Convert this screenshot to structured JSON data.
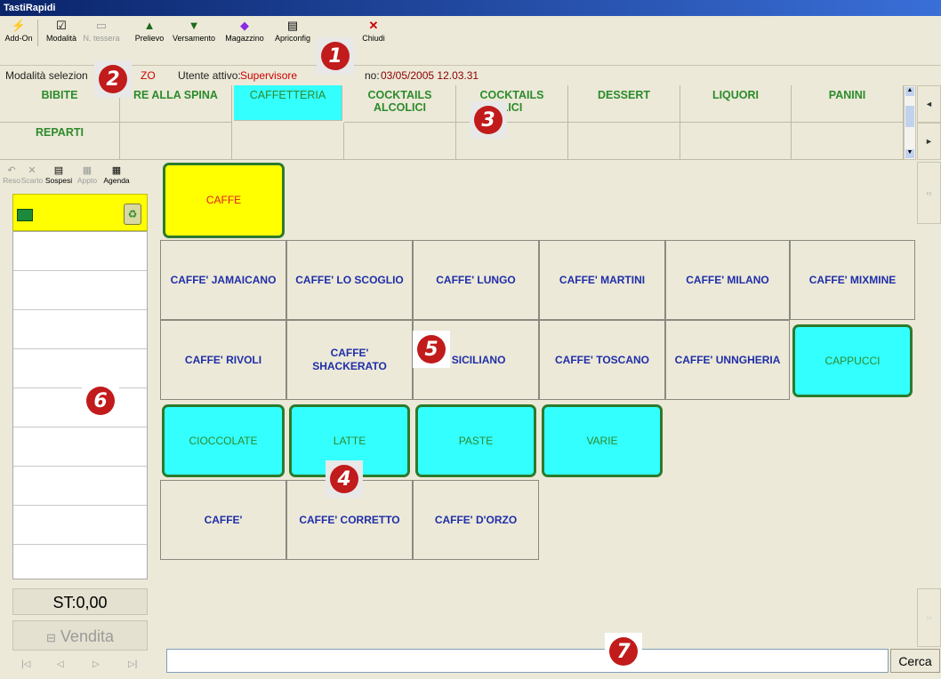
{
  "window": {
    "title": "TastiRapidi"
  },
  "toolbar": {
    "buttons": [
      {
        "label": "Add-On",
        "icon": "lightning-icon"
      },
      {
        "label": "Modalità",
        "icon": "checkbox-icon"
      },
      {
        "label": "N. tessera",
        "icon": "text-field-icon"
      },
      {
        "label": "Prelievo",
        "icon": "arrow-up-icon"
      },
      {
        "label": "Versamento",
        "icon": "arrow-down-icon"
      },
      {
        "label": "Magazzino",
        "icon": "boxes-icon"
      },
      {
        "label": "Apriconfig",
        "icon": "config-icon"
      },
      {
        "label": "Chiudi",
        "icon": "close-icon"
      }
    ]
  },
  "status": {
    "mode_label": "Modalità selezion",
    "mode_value": "ZO",
    "user_label": "Utente attivo:",
    "user_value": "Supervisore",
    "date_label": "no:",
    "date_value": "03/05/2005 12.03.31"
  },
  "categories": {
    "row1": [
      "BIBITE",
      "RE ALLA SPINA",
      "CAFFETTERIA",
      "COCKTAILS\nALCOLICI",
      "COCKTAILS\nLICI",
      "DESSERT",
      "LIQUORI",
      "PANINI"
    ],
    "row2": [
      "REPARTI"
    ],
    "selected": "CAFFETTERIA"
  },
  "nav": {
    "left": "◄",
    "right": "►",
    "collapse": "‹‹",
    "expand": "››"
  },
  "left_panel": {
    "buttons": [
      {
        "label": "Reso",
        "icon": "undo-icon"
      },
      {
        "label": "Scarto",
        "icon": "discard-icon"
      },
      {
        "label": "Sospesi",
        "icon": "suspended-icon"
      },
      {
        "label": "Appto",
        "icon": "appointment-icon"
      },
      {
        "label": "Agenda",
        "icon": "agenda-icon"
      }
    ],
    "subtotal": "ST:0,00",
    "sale_button": "Vendita",
    "nav_arrows": [
      "|◁",
      "◁",
      "▷",
      "▷|"
    ]
  },
  "products": {
    "top": "CAFFE",
    "row1": [
      "CAFFE' JAMAICANO",
      "CAFFE' LO SCOGLIO",
      "CAFFE' LUNGO",
      "CAFFE' MARTINI",
      "CAFFE' MILANO",
      "CAFFE' MIXMINE"
    ],
    "row2": [
      "CAFFE' RIVOLI",
      "CAFFE'\nSHACKERATO",
      "' SICILIANO",
      "CAFFE' TOSCANO",
      "CAFFE' UNNGHERIA",
      "CAPPUCCI"
    ],
    "row3": [
      "CIOCCOLATE",
      "LATTE",
      "PASTE",
      "VARIE"
    ],
    "row4": [
      "CAFFE'",
      "CAFFE' CORRETTO",
      "CAFFE' D'ORZO"
    ]
  },
  "search": {
    "value": "",
    "button": "Cerca"
  },
  "callouts": [
    "1",
    "2",
    "3",
    "4",
    "5",
    "6",
    "7"
  ],
  "colors": {
    "accent_cyan": "#33ffff",
    "highlight_yellow": "#ffff00",
    "category_green": "#2c8b2c",
    "product_blue": "#1f2ea8",
    "user_red": "#cc0000"
  }
}
